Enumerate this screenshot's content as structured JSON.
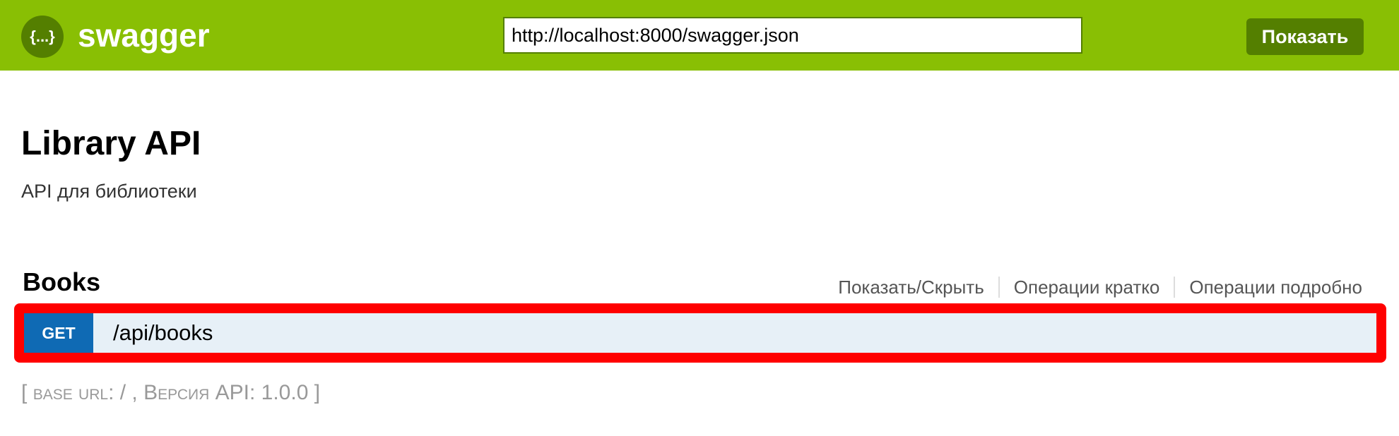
{
  "header": {
    "logo_icon": "{...}",
    "logo_text": "swagger",
    "url_value": "http://localhost:8000/swagger.json",
    "explore_label": "Показать",
    "bar_color": "#89bf04",
    "accent_color": "#547f00"
  },
  "info": {
    "title": "Library API",
    "description": "API для библиотеки"
  },
  "section": {
    "name": "Books",
    "links": [
      "Показать/Скрыть",
      "Операции кратко",
      "Операции подробно"
    ]
  },
  "endpoints": [
    {
      "method": "GET",
      "path": "/api/books",
      "method_color": "#0f6ab4",
      "row_color": "#e7f0f7"
    }
  ],
  "footer": {
    "open_bracket": "[",
    "base_url_label": "base url",
    "base_url_value": ": / , ",
    "version_label": "Версия",
    "version_value": " API: 1.0.0",
    "close_bracket": "]"
  }
}
